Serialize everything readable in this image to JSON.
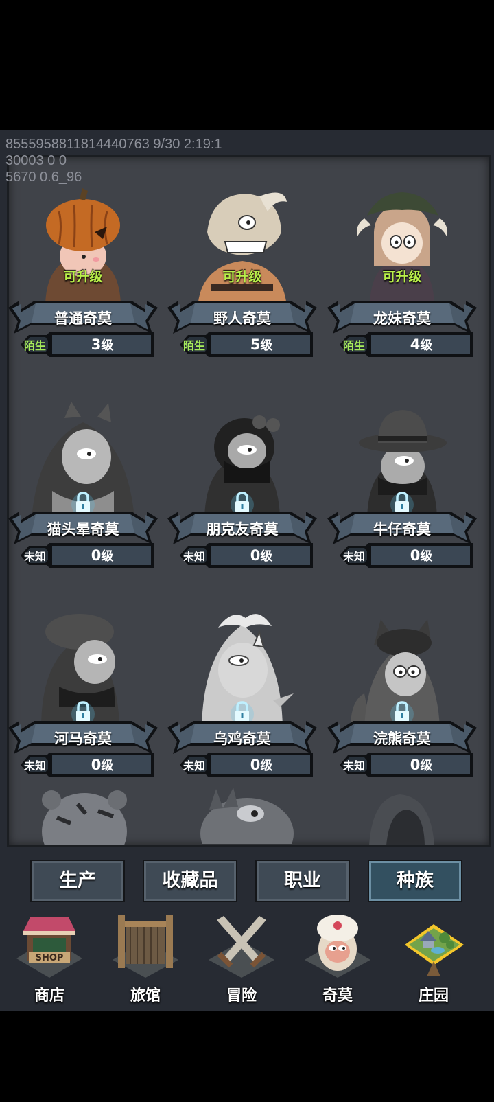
{
  "debug": [
    "8555958811814440763 9/30 2:19:1",
    "30003 0 0",
    "5670 0.6_96"
  ],
  "characters": [
    {
      "name": "普通奇莫",
      "status": "陌生",
      "level": "3",
      "level_suffix": "级",
      "upgrade": "可升级",
      "locked": false,
      "icon": "pumpkin-costume-icon"
    },
    {
      "name": "野人奇莫",
      "status": "陌生",
      "level": "5",
      "level_suffix": "级",
      "upgrade": "可升级",
      "locked": false,
      "icon": "savage-skull-icon"
    },
    {
      "name": "龙妹奇莫",
      "status": "陌生",
      "level": "4",
      "level_suffix": "级",
      "upgrade": "可升级",
      "locked": false,
      "icon": "dragon-girl-icon"
    },
    {
      "name": "猫头晕奇莫",
      "status": "未知",
      "level": "0",
      "level_suffix": "级",
      "upgrade": "",
      "locked": true,
      "icon": "cat-hood-icon"
    },
    {
      "name": "朋克友奇莫",
      "status": "未知",
      "level": "0",
      "level_suffix": "级",
      "upgrade": "",
      "locked": true,
      "icon": "punk-goggles-icon"
    },
    {
      "name": "牛仔奇莫",
      "status": "未知",
      "level": "0",
      "level_suffix": "级",
      "upgrade": "",
      "locked": true,
      "icon": "cowboy-hat-icon"
    },
    {
      "name": "河马奇莫",
      "status": "未知",
      "level": "0",
      "level_suffix": "级",
      "upgrade": "",
      "locked": true,
      "icon": "hippo-hood-icon"
    },
    {
      "name": "乌鸡奇莫",
      "status": "未知",
      "level": "0",
      "level_suffix": "级",
      "upgrade": "",
      "locked": true,
      "icon": "chicken-costume-icon"
    },
    {
      "name": "浣熊奇莫",
      "status": "未知",
      "level": "0",
      "level_suffix": "级",
      "upgrade": "",
      "locked": true,
      "icon": "raccoon-hood-icon"
    }
  ],
  "tabs": [
    {
      "label": "生产",
      "active": false
    },
    {
      "label": "收藏品",
      "active": false
    },
    {
      "label": "职业",
      "active": false
    },
    {
      "label": "种族",
      "active": true
    }
  ],
  "nav": [
    {
      "label": "商店",
      "icon": "shop-icon",
      "sign": "SHOP"
    },
    {
      "label": "旅馆",
      "icon": "inn-gate-icon"
    },
    {
      "label": "冒险",
      "icon": "crossed-swords-icon"
    },
    {
      "label": "奇莫",
      "icon": "kimo-character-icon"
    },
    {
      "label": "庄园",
      "icon": "floating-island-icon"
    }
  ],
  "colors": {
    "known_status": "#a6ec5a",
    "upgrade_text": "#b9f04a",
    "banner_fill": "#4b5a69",
    "panel_bg": "#404349",
    "active_tab": "#335060"
  }
}
